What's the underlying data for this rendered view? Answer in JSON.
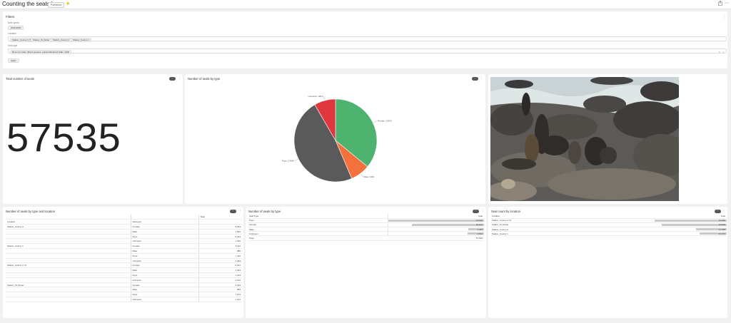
{
  "header": {
    "title": "Counting the seals !",
    "badge": "Published",
    "star": "★",
    "share_icon": "share-icon",
    "more_icon": "more-icon"
  },
  "filters": {
    "title": "Filters",
    "fields": [
      {
        "label": "Date (year)",
        "chips": [
          "2020-2022"
        ]
      },
      {
        "label": "Location",
        "chips": [
          "Station_Colony 2 (?)",
          "Station_Sl_Roder",
          "Station_Colony A",
          "Station_Colony 1"
        ]
      },
      {
        "label": "Seal type",
        "chips": [
          "Brown Female, Mixed puppies, Lastest Elephant Male, 2020"
        ]
      }
    ],
    "apply": "Apply"
  },
  "kpi": {
    "title": "Total number of seals",
    "value": "57535"
  },
  "pie": {
    "title": "Number of seals by type"
  },
  "chart_data": {
    "type": "pie",
    "labels": [
      "Female",
      "Male",
      "Pups",
      "Unknown"
    ],
    "values": [
      20672,
      4403,
      27648,
      4812
    ],
    "data_labels": [
      "Female: 20672",
      "Male: 4403",
      "Pups: 27648",
      "Unknown: 4812"
    ],
    "colors": [
      "#4db36f",
      "#f5713b",
      "#5a5a5a",
      "#e0363e"
    ]
  },
  "typeloc": {
    "title": "Number of seals by type and location",
    "header": [
      "",
      "Total"
    ],
    "subheader": [
      "Location",
      "Seal type",
      ""
    ],
    "rows": [
      [
        "Station_Colony A",
        "Female",
        "5,504"
      ],
      [
        "",
        "Male",
        "1,520"
      ],
      [
        "",
        "Pups",
        "6,024"
      ],
      [
        "",
        "Unknown",
        "1,320"
      ],
      [
        "Station_Colony 1",
        "Female",
        "5,112"
      ],
      [
        "",
        "Male",
        "980"
      ],
      [
        "",
        "Pups",
        "7,116"
      ],
      [
        "",
        "Unknown",
        "1,064"
      ],
      [
        "Station_Colony 2 (?)",
        "Female",
        "5,612"
      ],
      [
        "",
        "Male",
        "1,004"
      ],
      [
        "",
        "Pups",
        "7,404"
      ],
      [
        "",
        "Unknown",
        "1,216"
      ],
      [
        "Station_Sl_Roder",
        "Female",
        "4,444"
      ],
      [
        "",
        "Male",
        "899"
      ],
      [
        "",
        "Pups",
        "7,104"
      ],
      [
        "",
        "Unknown",
        "1,212"
      ]
    ]
  },
  "bytype": {
    "title": "Number of seals by type",
    "header": [
      "Seal Type",
      "Total"
    ],
    "rows": [
      {
        "label": "Pups",
        "value": "27,648",
        "pct": 100
      },
      {
        "label": "Female",
        "value": "20,672",
        "pct": 75
      },
      {
        "label": "Male",
        "value": "4,403",
        "pct": 16
      },
      {
        "label": "Unknown",
        "value": "4,812",
        "pct": 17
      }
    ],
    "total_label": "Total",
    "total_value": "57,535"
  },
  "byloc": {
    "title": "Seal count by location",
    "header": [
      "Location",
      "Total"
    ],
    "rows": [
      {
        "label": "Station_Colony 2 (?)",
        "value": "15,236",
        "pct": 100
      },
      {
        "label": "Station_Sl_Roder",
        "value": "13,659",
        "pct": 90
      },
      {
        "label": "Station_Colony A",
        "value": "14,368",
        "pct": 43
      },
      {
        "label": "Station_Colony 1",
        "value": "14,272",
        "pct": 38
      }
    ]
  }
}
